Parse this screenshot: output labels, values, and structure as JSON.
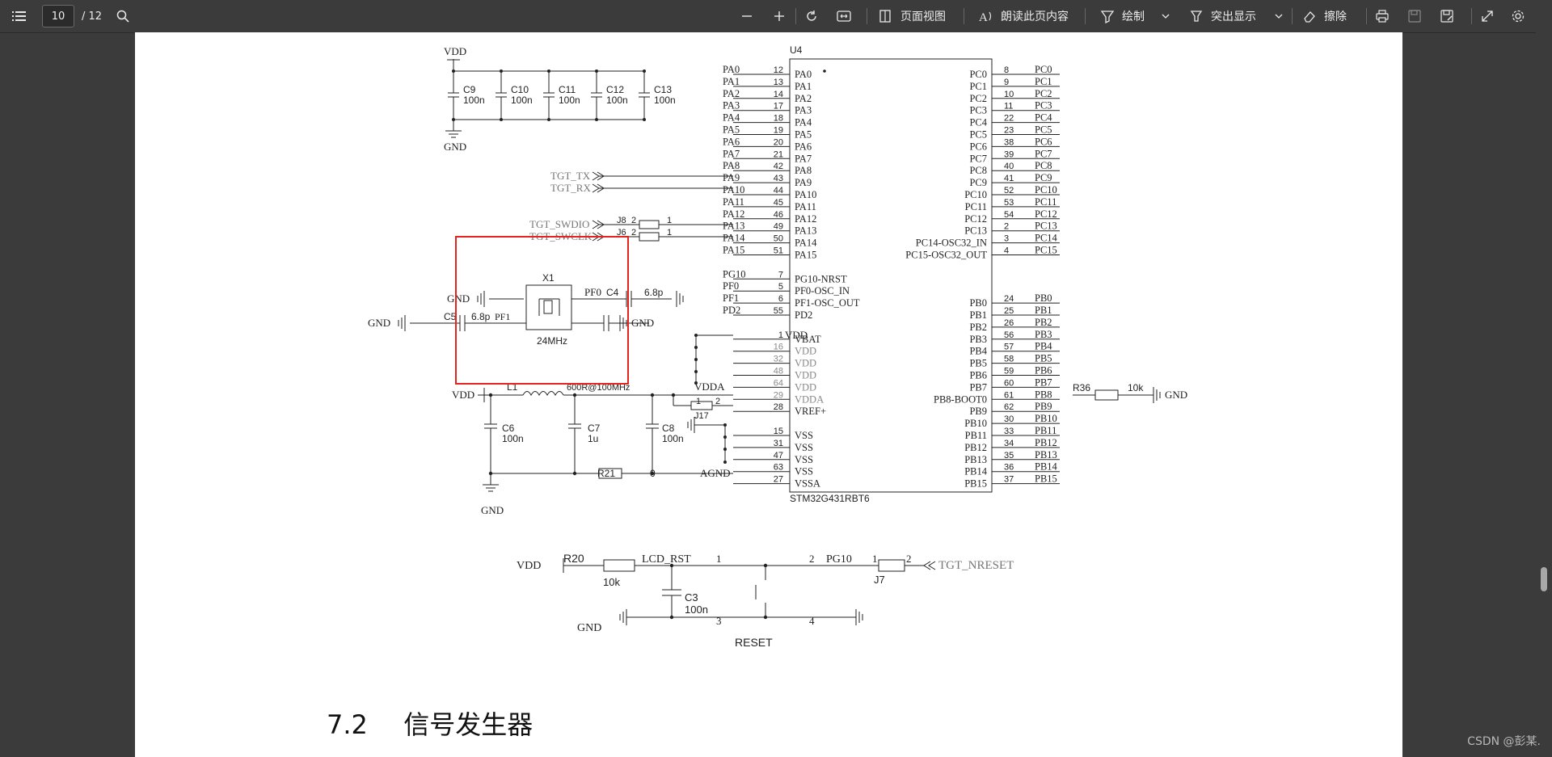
{
  "toolbar": {
    "page_current": "10",
    "page_total": "/ 12",
    "page_view_label": "页面视图",
    "read_aloud_label": "朗读此页内容",
    "draw_label": "绘制",
    "highlight_label": "突出显示",
    "erase_label": "擦除"
  },
  "schematic": {
    "decoupling": {
      "vdd": "VDD",
      "gnd": "GND",
      "caps": [
        {
          "name": "C9",
          "value": "100n"
        },
        {
          "name": "C10",
          "value": "100n"
        },
        {
          "name": "C11",
          "value": "100n"
        },
        {
          "name": "C12",
          "value": "100n"
        },
        {
          "name": "C13",
          "value": "100n"
        }
      ]
    },
    "mcu": {
      "ref": "U4",
      "part": "STM32G431RBT6",
      "left_pins": [
        {
          "net": "PA0",
          "num": "12",
          "name": "PA0"
        },
        {
          "net": "PA1",
          "num": "13",
          "name": "PA1"
        },
        {
          "net": "PA2",
          "num": "14",
          "name": "PA2"
        },
        {
          "net": "PA3",
          "num": "17",
          "name": "PA3"
        },
        {
          "net": "PA4",
          "num": "18",
          "name": "PA4"
        },
        {
          "net": "PA5",
          "num": "19",
          "name": "PA5"
        },
        {
          "net": "PA6",
          "num": "20",
          "name": "PA6"
        },
        {
          "net": "PA7",
          "num": "21",
          "name": "PA7"
        },
        {
          "net": "PA8",
          "num": "42",
          "name": "PA8"
        },
        {
          "net": "PA9",
          "num": "43",
          "name": "PA9"
        },
        {
          "net": "PA10",
          "num": "44",
          "name": "PA10"
        },
        {
          "net": "PA11",
          "num": "45",
          "name": "PA11"
        },
        {
          "net": "PA12",
          "num": "46",
          "name": "PA12"
        },
        {
          "net": "PA13",
          "num": "49",
          "name": "PA13"
        },
        {
          "net": "PA14",
          "num": "50",
          "name": "PA14"
        },
        {
          "net": "PA15",
          "num": "51",
          "name": "PA15"
        },
        {
          "net": "",
          "num": "",
          "name": ""
        },
        {
          "net": "PG10",
          "num": "7",
          "name": "PG10-NRST"
        },
        {
          "net": "PF0",
          "num": "5",
          "name": "PF0-OSC_IN"
        },
        {
          "net": "PF1",
          "num": "6",
          "name": "PF1-OSC_OUT"
        },
        {
          "net": "PD2",
          "num": "55",
          "name": "PD2"
        },
        {
          "net": "",
          "num": "",
          "name": ""
        },
        {
          "net": "",
          "num": "1",
          "name": "VBAT"
        },
        {
          "net": "",
          "num": "16",
          "name": "VDD"
        },
        {
          "net": "",
          "num": "32",
          "name": "VDD"
        },
        {
          "net": "",
          "num": "48",
          "name": "VDD"
        },
        {
          "net": "",
          "num": "64",
          "name": "VDD"
        },
        {
          "net": "",
          "num": "29",
          "name": "VDDA"
        },
        {
          "net": "",
          "num": "28",
          "name": "VREF+"
        },
        {
          "net": "",
          "num": "",
          "name": ""
        },
        {
          "net": "",
          "num": "15",
          "name": "VSS"
        },
        {
          "net": "",
          "num": "31",
          "name": "VSS"
        },
        {
          "net": "",
          "num": "47",
          "name": "VSS"
        },
        {
          "net": "",
          "num": "63",
          "name": "VSS"
        },
        {
          "net": "",
          "num": "27",
          "name": "VSSA"
        }
      ],
      "right_pins": [
        {
          "net": "PC0",
          "num": "8",
          "name": "PC0"
        },
        {
          "net": "PC1",
          "num": "9",
          "name": "PC1"
        },
        {
          "net": "PC2",
          "num": "10",
          "name": "PC2"
        },
        {
          "net": "PC3",
          "num": "11",
          "name": "PC3"
        },
        {
          "net": "PC4",
          "num": "22",
          "name": "PC4"
        },
        {
          "net": "PC5",
          "num": "23",
          "name": "PC5"
        },
        {
          "net": "PC6",
          "num": "38",
          "name": "PC6"
        },
        {
          "net": "PC7",
          "num": "39",
          "name": "PC7"
        },
        {
          "net": "PC8",
          "num": "40",
          "name": "PC8"
        },
        {
          "net": "PC9",
          "num": "41",
          "name": "PC9"
        },
        {
          "net": "PC10",
          "num": "52",
          "name": "PC10"
        },
        {
          "net": "PC11",
          "num": "53",
          "name": "PC11"
        },
        {
          "net": "PC12",
          "num": "54",
          "name": "PC12"
        },
        {
          "net": "PC13",
          "num": "2",
          "name": "PC13"
        },
        {
          "net": "PC14",
          "num": "3",
          "name": "PC14-OSC32_IN"
        },
        {
          "net": "PC15",
          "num": "4",
          "name": "PC15-OSC32_OUT"
        },
        {
          "net": "",
          "num": "",
          "name": ""
        },
        {
          "net": "",
          "num": "",
          "name": ""
        },
        {
          "net": "",
          "num": "",
          "name": ""
        },
        {
          "net": "PB0",
          "num": "24",
          "name": "PB0"
        },
        {
          "net": "PB1",
          "num": "25",
          "name": "PB1"
        },
        {
          "net": "PB2",
          "num": "26",
          "name": "PB2"
        },
        {
          "net": "PB3",
          "num": "56",
          "name": "PB3"
        },
        {
          "net": "PB4",
          "num": "57",
          "name": "PB4"
        },
        {
          "net": "PB5",
          "num": "58",
          "name": "PB5"
        },
        {
          "net": "PB6",
          "num": "59",
          "name": "PB6"
        },
        {
          "net": "PB7",
          "num": "60",
          "name": "PB7"
        },
        {
          "net": "PB8",
          "num": "61",
          "name": "PB8-BOOT0"
        },
        {
          "net": "PB9",
          "num": "62",
          "name": "PB9"
        },
        {
          "net": "PB10",
          "num": "30",
          "name": "PB10"
        },
        {
          "net": "PB11",
          "num": "33",
          "name": "PB11"
        },
        {
          "net": "PB12",
          "num": "34",
          "name": "PB12"
        },
        {
          "net": "PB13",
          "num": "35",
          "name": "PB13"
        },
        {
          "net": "PB14",
          "num": "36",
          "name": "PB14"
        },
        {
          "net": "PB15",
          "num": "37",
          "name": "PB15"
        }
      ]
    },
    "nets": {
      "tgt_tx": "TGT_TX",
      "tgt_rx": "TGT_RX",
      "tgt_swdio": "TGT_SWDIO",
      "tgt_swclk": "TGT_SWCLK",
      "tgt_nreset": "TGT_NRESET",
      "vdda": "VDDA",
      "agnd": "AGND",
      "lcd_rst": "LCD_RST",
      "pg10": "PG10"
    },
    "jumpers": {
      "j8": "J8",
      "j6": "J6",
      "j17": "J17",
      "j7": "J7",
      "pin1": "1",
      "pin2": "2"
    },
    "crystal": {
      "ref": "X1",
      "freq": "24MHz",
      "c4": "C4",
      "c4_val": "6.8p",
      "c5": "C5",
      "c5_val": "6.8p",
      "pf0": "PF0",
      "pf1": "PF1",
      "gnd": "GND",
      "highlight_color": "#e8231f"
    },
    "analog": {
      "vdd": "VDD",
      "l1": "L1",
      "l1_val": "600R@100MHz",
      "c6": "C6",
      "c6_val": "100n",
      "c7": "C7",
      "c7_val": "1u",
      "c8": "C8",
      "c8_val": "100n",
      "r21": "R21",
      "r21_val": "0",
      "gnd": "GND",
      "vdd_mcu": "VDD"
    },
    "boot": {
      "r36": "R36",
      "r36_val": "10k",
      "gnd": "GND"
    },
    "reset": {
      "vdd": "VDD",
      "r20": "R20",
      "r20_val": "10k",
      "c3": "C3",
      "c3_val": "100n",
      "gnd": "GND",
      "label": "RESET",
      "sw1": "1",
      "sw2": "2",
      "sw3": "3",
      "sw4": "4"
    }
  },
  "heading": {
    "number": "7.2",
    "title": "信号发生器"
  },
  "watermark": "CSDN @彭某."
}
